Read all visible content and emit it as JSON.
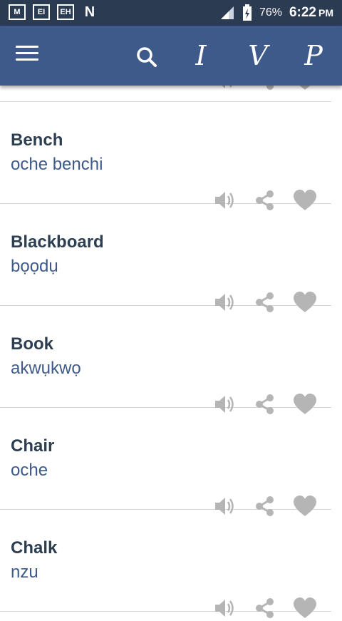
{
  "status_bar": {
    "notifications": [
      "M",
      "EI",
      "EH",
      "N"
    ],
    "battery": "76%",
    "time": "6:22",
    "ampm": "PM"
  },
  "app_bar": {
    "buttons": [
      "I",
      "V",
      "P"
    ]
  },
  "entries": [
    {
      "word": "Bench",
      "translation": "oche benchi"
    },
    {
      "word": "Blackboard",
      "translation": "bọọdụ"
    },
    {
      "word": "Book",
      "translation": "akwụkwọ"
    },
    {
      "word": "Chair",
      "translation": "oche"
    },
    {
      "word": "Chalk",
      "translation": "nzu"
    }
  ],
  "colors": {
    "status_bar": "#2b3b52",
    "app_bar": "#3d5a8a",
    "word": "#2d3e50",
    "translation": "#3d5a8a",
    "action_icon": "#b5b5b5",
    "divider": "#d5d5d5"
  },
  "icons": {
    "menu": "hamburger-icon",
    "search": "search-icon",
    "speak": "speaker-icon",
    "share": "share-icon",
    "favorite": "heart-icon"
  }
}
